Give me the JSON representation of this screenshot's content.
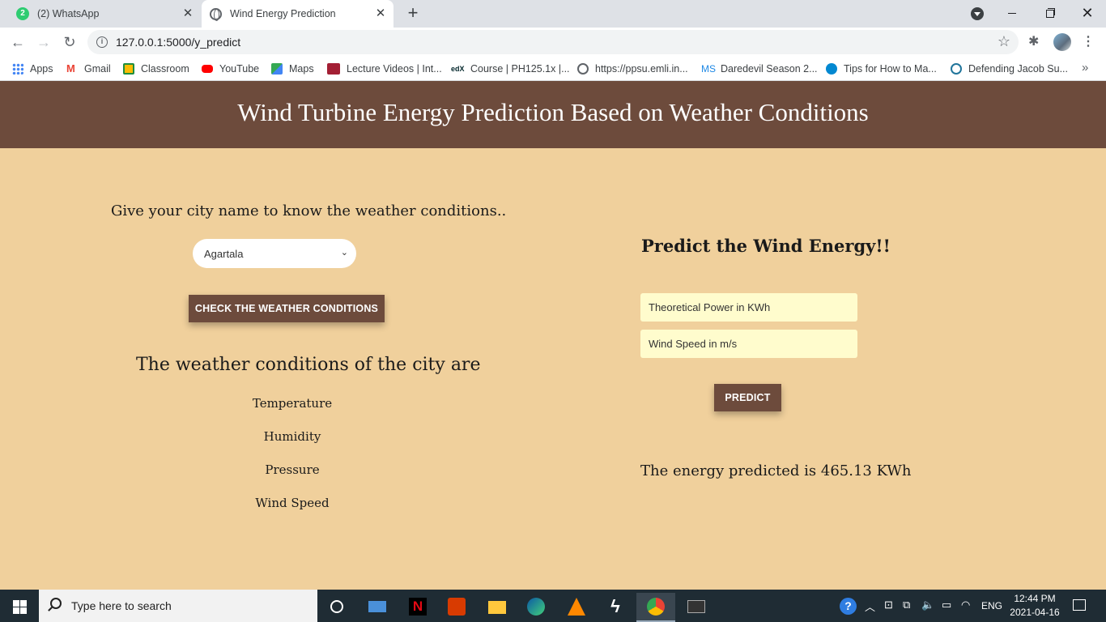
{
  "browser": {
    "tabs": [
      {
        "title": "(2) WhatsApp",
        "badge": "2"
      },
      {
        "title": "Wind Energy Prediction"
      }
    ],
    "url": "127.0.0.1:5000/y_predict",
    "bookmarks": [
      {
        "label": "Apps",
        "icon": "apps-grid-icon",
        "color": "#4285f4"
      },
      {
        "label": "Gmail",
        "icon": "gmail-icon",
        "color": "#ea4335"
      },
      {
        "label": "Classroom",
        "icon": "classroom-icon",
        "color": "#fbbc04"
      },
      {
        "label": "YouTube",
        "icon": "youtube-icon",
        "color": "#ff0000"
      },
      {
        "label": "Maps",
        "icon": "maps-icon",
        "color": "#34a853"
      },
      {
        "label": "Lecture Videos | Int...",
        "icon": "mit-ocw-icon",
        "color": "#a31f34"
      },
      {
        "label": "Course | PH125.1x |...",
        "icon": "edx-icon",
        "color": "#02262b"
      },
      {
        "label": "https://ppsu.emli.in...",
        "icon": "globe-icon",
        "color": "#5f6368"
      },
      {
        "label": "Daredevil Season 2...",
        "icon": "ms-icon",
        "color": "#1e88e5"
      },
      {
        "label": "Tips for How to Ma...",
        "icon": "home-icon",
        "color": "#0288d1"
      },
      {
        "label": "Defending Jacob Su...",
        "icon": "wordpress-icon",
        "color": "#21759b"
      }
    ]
  },
  "page": {
    "title": "Wind Turbine Energy Prediction Based on Weather Conditions",
    "city_prompt": "Give your city name to know the weather conditions..",
    "city_selected": "Agartala",
    "check_button": "Check the weather conditions",
    "weather_heading": "The weather conditions of the city are",
    "weather_items": [
      "Temperature",
      "Humidity",
      "Pressure",
      "Wind Speed"
    ],
    "predict_heading": "Predict the Wind Energy!!",
    "power_placeholder": "Theoretical Power in KWh",
    "speed_placeholder": "Wind Speed in m/s",
    "predict_button": "Predict",
    "result": "The energy predicted is 465.13 KWh"
  },
  "colors": {
    "header_bg": "#6d4b3c",
    "page_bg": "#f0d09c",
    "input_bg": "#fffccd"
  },
  "taskbar": {
    "search_placeholder": "Type here to search",
    "apps": [
      "cortana-icon",
      "laptop-icon",
      "netflix-icon",
      "office-icon",
      "file-explorer-icon",
      "edge-icon",
      "vlc-icon",
      "app-s-icon",
      "chrome-icon",
      "terminal-icon"
    ],
    "lang": "ENG",
    "time": "12:44 PM",
    "date": "2021-04-16"
  }
}
